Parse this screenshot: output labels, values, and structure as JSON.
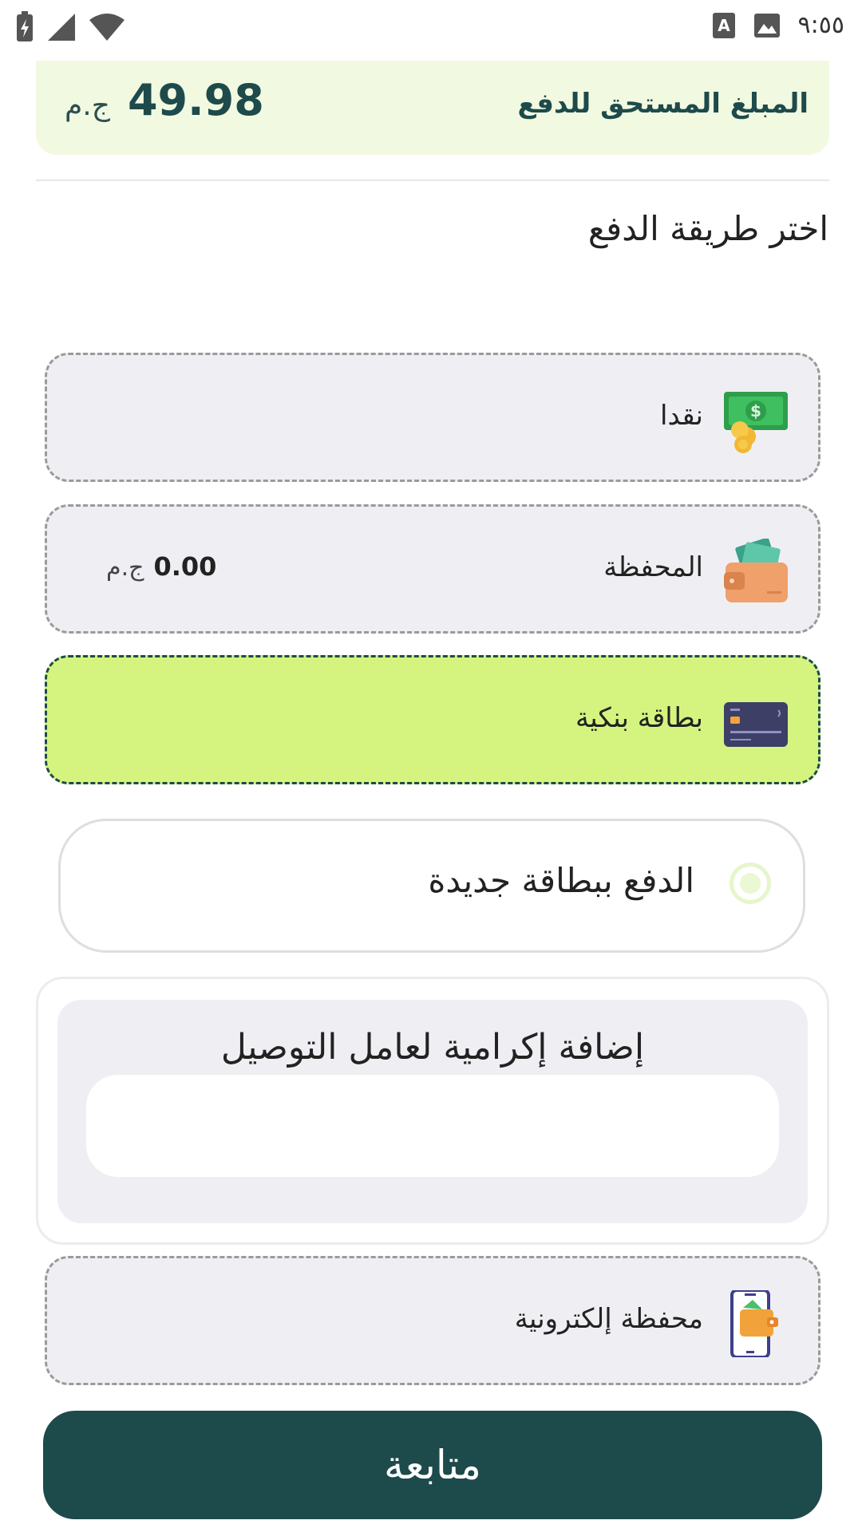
{
  "status_bar": {
    "time": "٩:٥٥",
    "icons": [
      "battery-charging-icon",
      "signal-icon",
      "wifi-icon",
      "keyboard-a-icon",
      "image-icon"
    ]
  },
  "amount_due": {
    "label": "المبلغ المستحق للدفع",
    "value": "49.98",
    "currency": "ج.م"
  },
  "payment_section": {
    "title": "اختر طريقة الدفع"
  },
  "payment_options": [
    {
      "label": "نقدا",
      "icon": "cash-coins-icon",
      "selected": false
    },
    {
      "label": "المحفظة",
      "icon": "wallet-icon",
      "balance": "0.00",
      "currency": "ج.م",
      "selected": false
    },
    {
      "label": "بطاقة بنكية",
      "icon": "credit-card-icon",
      "selected": true
    }
  ],
  "new_card": {
    "label": "الدفع ببطاقة جديدة"
  },
  "tip": {
    "title": "إضافة إكرامية لعامل التوصيل",
    "value": "",
    "placeholder": ""
  },
  "e_wallet": {
    "label": "محفظة إلكترونية",
    "icon": "mobile-wallet-icon"
  },
  "continue_button": {
    "label": "متابعة"
  },
  "colors": {
    "primary": "#1d4a4b",
    "selected_bg": "#d5f47f",
    "amount_bg": "#f1f9e1",
    "option_bg": "#efeff3"
  }
}
